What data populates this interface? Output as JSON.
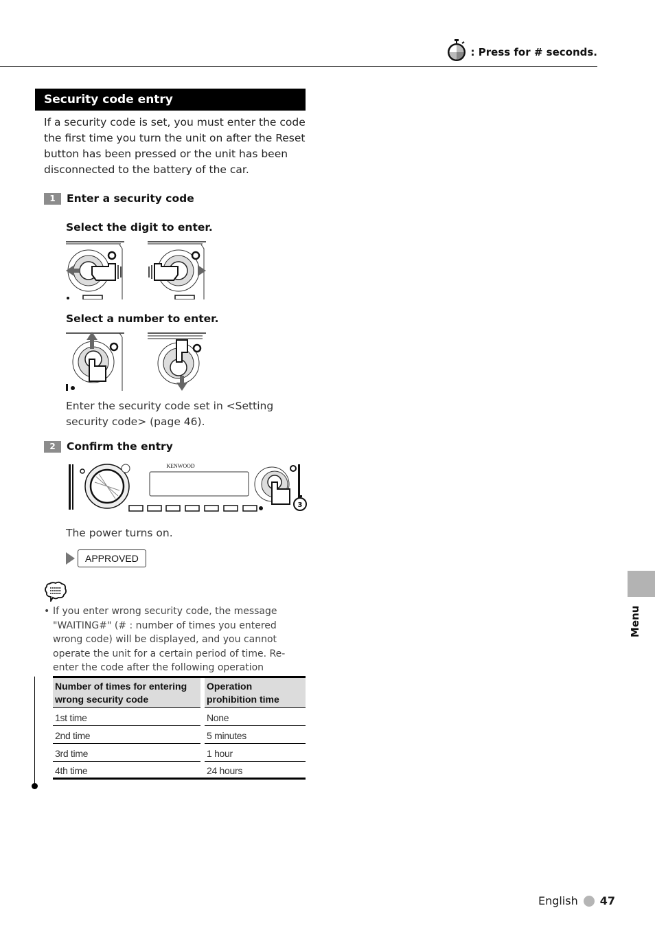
{
  "header": {
    "legend_icon": "stopwatch-icon",
    "legend_text": ": Press for # seconds."
  },
  "section": {
    "title": "Security code entry",
    "intro": "If a security code is set, you must enter the code the first time you turn the unit on after the Reset button has been pressed or the unit has been disconnected to the battery of the car."
  },
  "steps": [
    {
      "number": "1",
      "title": "Enter a security code",
      "substeps": [
        {
          "title": "Select the digit to enter.",
          "illustrations": [
            "knob-push-left",
            "knob-push-right"
          ]
        },
        {
          "title": "Select a number to enter.",
          "illustrations": [
            "knob-push-up",
            "knob-push-down"
          ]
        }
      ],
      "note": "Enter the security code set in <Setting security code> (page 46)."
    },
    {
      "number": "2",
      "title": "Confirm the entry",
      "illustration": {
        "brand": "KENWOOD",
        "hold_seconds": "3"
      },
      "result": "The power turns on.",
      "display_message": "APPROVED"
    }
  ],
  "note": {
    "icon": "note-speech-bubble-icon",
    "bullet": "•",
    "text": "If you enter wrong security code, the message \"WAITING#\" (# : number of times you entered wrong code) will be displayed, and you cannot operate the unit for a certain period of time. Re-enter the code after the following operation prohibition time is passed."
  },
  "table": {
    "headers": [
      "Number of times for entering wrong security code",
      "Operation prohibition time"
    ],
    "rows": [
      [
        "1st time",
        "None"
      ],
      [
        "2nd time",
        "5 minutes"
      ],
      [
        "3rd time",
        "1 hour"
      ],
      [
        "4th time",
        "24 hours"
      ]
    ]
  },
  "side_tab": {
    "label": "Menu"
  },
  "footer": {
    "language": "English",
    "page": "47"
  }
}
